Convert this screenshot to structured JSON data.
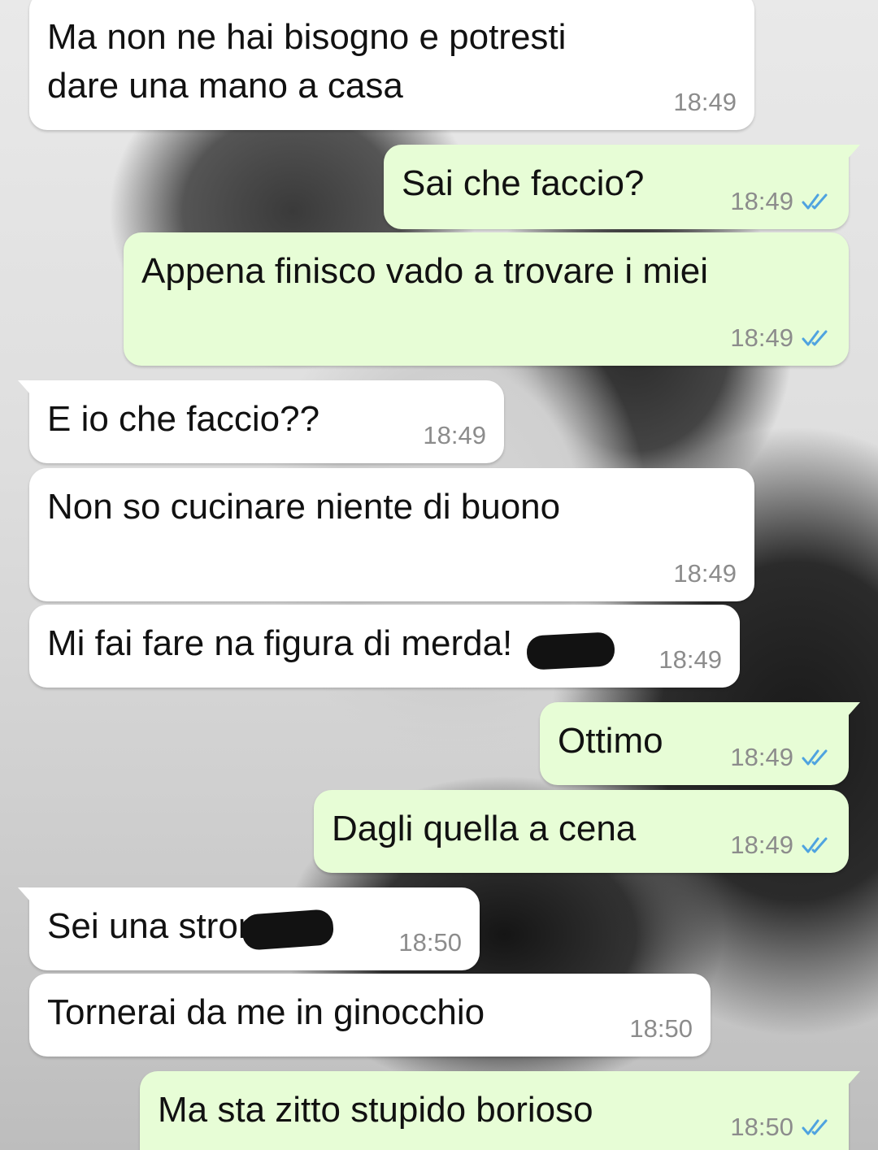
{
  "theme": {
    "incoming_bubble": "#ffffff",
    "outgoing_bubble": "#e7fdd6",
    "text_color": "#111111",
    "time_color": "#8c8c8c",
    "read_tick_color": "#4fa3e0"
  },
  "messages": [
    {
      "direction": "incoming",
      "text": "Ma non ne hai bisogno e potresti\ndare una mano a casa",
      "time": "18:49"
    },
    {
      "direction": "outgoing",
      "text": "Sai che faccio?",
      "time": "18:49",
      "status_icon": "double-check-read-icon"
    },
    {
      "direction": "outgoing",
      "text": "Appena finisco vado a trovare i miei",
      "time": "18:49",
      "status_icon": "double-check-read-icon"
    },
    {
      "direction": "incoming",
      "text": "E io che faccio??",
      "time": "18:49"
    },
    {
      "direction": "incoming",
      "text": "Non so cucinare niente di buono",
      "time": "18:49"
    },
    {
      "direction": "incoming",
      "text": "Mi fai fare na figura di merda!",
      "time": "18:49",
      "redacted": true
    },
    {
      "direction": "outgoing",
      "text": "Ottimo",
      "time": "18:49",
      "status_icon": "double-check-read-icon"
    },
    {
      "direction": "outgoing",
      "text": "Dagli quella a cena",
      "time": "18:49",
      "status_icon": "double-check-read-icon"
    },
    {
      "direction": "incoming",
      "text": "Sei una stronza",
      "time": "18:50",
      "redacted": true
    },
    {
      "direction": "incoming",
      "text": "Tornerai da me in ginocchio",
      "time": "18:50"
    },
    {
      "direction": "outgoing",
      "text": "Ma sta zitto stupido borioso",
      "time": "18:50",
      "status_icon": "double-check-read-icon"
    }
  ]
}
